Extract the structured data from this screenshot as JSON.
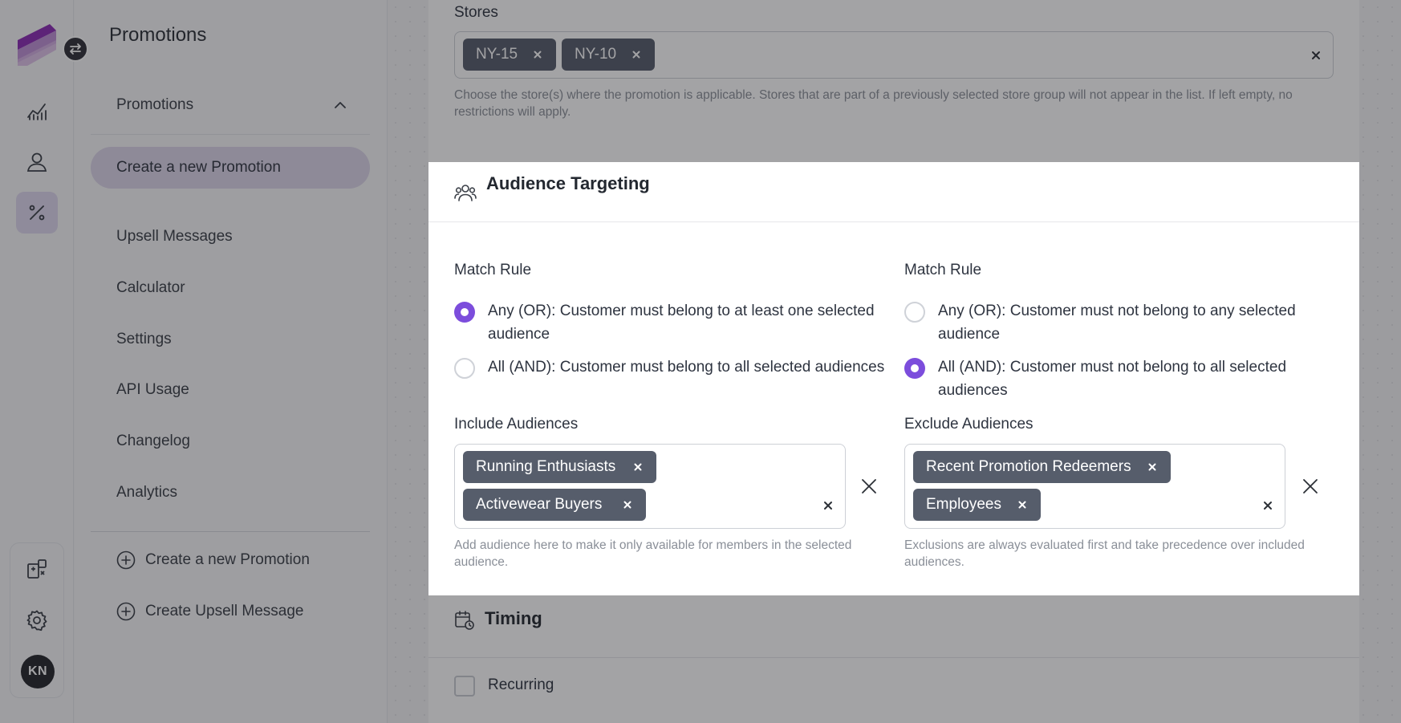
{
  "app": {
    "title": "Promotions",
    "user_initials": "KN"
  },
  "rail": {
    "icons": [
      "chart-icon",
      "user-icon",
      "percent-icon",
      "puzzle-icon",
      "gear-icon"
    ],
    "active": "percent-icon"
  },
  "sidebar": {
    "section": {
      "label": "Promotions",
      "expanded": true
    },
    "active_item": "Create a new Promotion",
    "items": [
      {
        "label": "Upsell Messages"
      },
      {
        "label": "Calculator"
      },
      {
        "label": "Settings"
      },
      {
        "label": "API Usage"
      },
      {
        "label": "Changelog"
      },
      {
        "label": "Analytics"
      }
    ],
    "actions": [
      {
        "label": "Create a new Promotion",
        "icon": "plus-circle-icon"
      },
      {
        "label": "Create Upsell Message",
        "icon": "plus-circle-icon"
      }
    ]
  },
  "stores": {
    "label": "Stores",
    "tags": [
      "NY-15",
      "NY-10"
    ],
    "help": "Choose the store(s) where the promotion is applicable. Stores that are part of a previously selected store group will not appear in the list. If left empty, no restrictions will apply."
  },
  "audience": {
    "title": "Audience Targeting",
    "include": {
      "match_label": "Match Rule",
      "options": [
        {
          "text": "Any (OR): Customer must belong to at least one selected audience",
          "checked": true
        },
        {
          "text": "All (AND): Customer must belong to all selected audiences",
          "checked": false
        }
      ],
      "label": "Include Audiences",
      "tags": [
        "Running Enthusiasts",
        "Activewear Buyers"
      ],
      "help": "Add audience here to make it only available for members in the selected audience."
    },
    "exclude": {
      "match_label": "Match Rule",
      "options": [
        {
          "text": "Any (OR): Customer must not belong to any selected audience",
          "checked": false
        },
        {
          "text": "All (AND): Customer must not belong to all selected audiences",
          "checked": true
        }
      ],
      "label": "Exclude Audiences",
      "tags": [
        "Recent Promotion Redeemers",
        "Employees"
      ],
      "help": "Exclusions are always evaluated first and take precedence over included audiences."
    }
  },
  "timing": {
    "title": "Timing",
    "recurring_label": "Recurring",
    "recurring_checked": false
  },
  "colors": {
    "accent": "#7c4ddc",
    "tag_bg": "#565d6b",
    "active_nav_bg": "#dcd6ea"
  }
}
